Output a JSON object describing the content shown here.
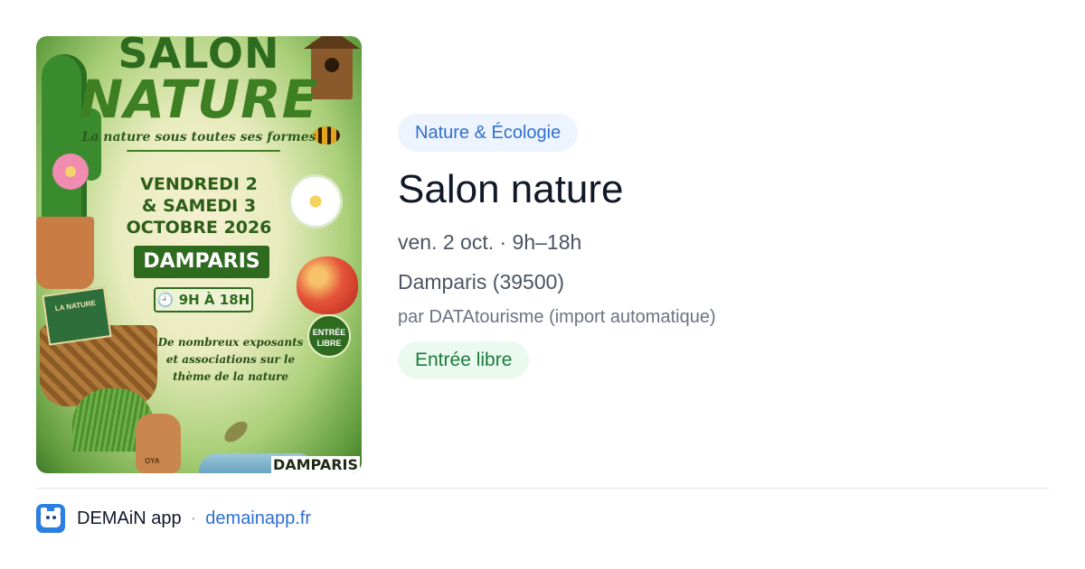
{
  "poster": {
    "title_line1": "SALON",
    "title_line2": "NATURE",
    "tagline": "La nature sous toutes ses formes",
    "dates_line1": "VENDREDI 2",
    "dates_line2": "& SAMEDI 3",
    "dates_line3": "OCTOBRE 2026",
    "place": "DAMPARIS",
    "hours": "🕘 9H À 18H",
    "free_line1": "ENTRÉE",
    "free_line2": "LIBRE",
    "exposants": "De nombreux exposants et associations sur le thème de la nature",
    "book_text": "LA NATURE",
    "jar_text": "OYA",
    "brand": "DAMPARIS"
  },
  "event": {
    "category": "Nature & Écologie",
    "title": "Salon nature",
    "when": "ven. 2 oct. · 9h–18h",
    "where": "Damparis (39500)",
    "source": "par DATAtourisme (import automatique)",
    "price": "Entrée libre"
  },
  "footer": {
    "app_name": "DEMAiN app",
    "separator": "·",
    "domain": "demainapp.fr"
  },
  "colors": {
    "category_bg": "#eef4fd",
    "category_text": "#2f6fcf",
    "price_bg": "#ebfaef",
    "price_text": "#1b7a3c",
    "link": "#2f6fcf"
  }
}
